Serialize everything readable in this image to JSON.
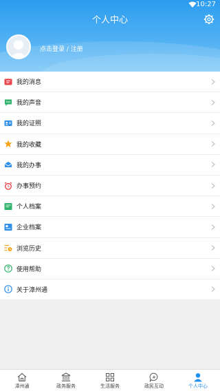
{
  "status": {
    "time": "10:27"
  },
  "header": {
    "title": "个人中心",
    "login_text": "点击登录 / 注册"
  },
  "menu": [
    {
      "label": "我的消息",
      "icon": "message-icon",
      "color": "#e9464b"
    },
    {
      "label": "我的声音",
      "icon": "speech-bubble-icon",
      "color": "#32b36b"
    },
    {
      "label": "我的证照",
      "icon": "id-card-icon",
      "color": "#2f8fe8"
    },
    {
      "label": "我的收藏",
      "icon": "star-icon",
      "color": "#f3a51c"
    },
    {
      "label": "我的办事",
      "icon": "envelope-icon",
      "color": "#2f8fe8"
    },
    {
      "label": "办事预约",
      "icon": "alarm-clock-icon",
      "color": "#e9464b"
    },
    {
      "label": "个人档案",
      "icon": "personal-file-icon",
      "color": "#32b36b"
    },
    {
      "label": "企业档案",
      "icon": "enterprise-file-icon",
      "color": "#2f8fe8"
    },
    {
      "label": "浏览历史",
      "icon": "history-icon",
      "color": "#f3a51c"
    },
    {
      "label": "使用帮助",
      "icon": "help-icon",
      "color": "#32b36b"
    },
    {
      "label": "关于漳州通",
      "icon": "info-icon",
      "color": "#2f8fe8"
    }
  ],
  "tabbar": [
    {
      "label": "漳州通",
      "icon": "home-icon",
      "active": false
    },
    {
      "label": "政务服务",
      "icon": "government-icon",
      "active": false
    },
    {
      "label": "生活服务",
      "icon": "grid-icon",
      "active": false
    },
    {
      "label": "政民互动",
      "icon": "interaction-icon",
      "active": false
    },
    {
      "label": "个人中心",
      "icon": "person-icon",
      "active": true
    }
  ],
  "colors": {
    "accent": "#1f8ff0",
    "header_top": "#2c9cf0",
    "header_bottom": "#7cc6f6"
  }
}
